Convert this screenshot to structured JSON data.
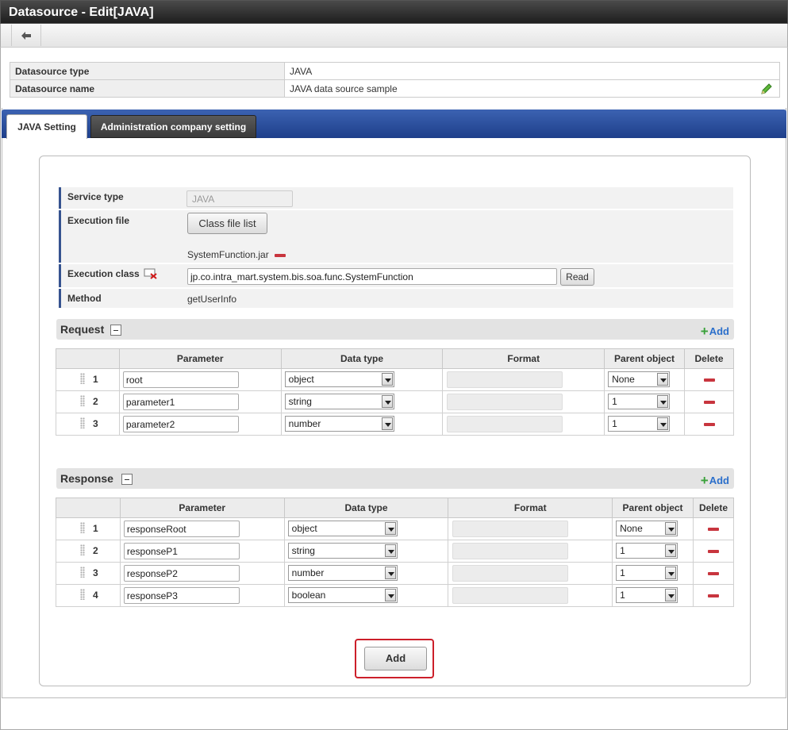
{
  "window": {
    "title": "Datasource - Edit[JAVA]"
  },
  "info": {
    "rows": [
      {
        "label": "Datasource type",
        "value": "JAVA"
      },
      {
        "label": "Datasource name",
        "value": "JAVA data source sample"
      }
    ]
  },
  "tabs": [
    {
      "label": "JAVA Setting",
      "active": true
    },
    {
      "label": "Administration company setting",
      "active": false
    }
  ],
  "settings": {
    "service_type_label": "Service type",
    "service_type_value": "JAVA",
    "execution_file_label": "Execution file",
    "class_file_list_button": "Class file list",
    "file_name": "SystemFunction.jar",
    "execution_class_label": "Execution class",
    "execution_class_value": "jp.co.intra_mart.system.bis.soa.func.SystemFunction",
    "read_button": "Read",
    "method_label": "Method",
    "method_value": "getUserInfo"
  },
  "request": {
    "title": "Request",
    "add_label": "Add",
    "columns": [
      "Parameter",
      "Data type",
      "Format",
      "Parent object",
      "Delete"
    ],
    "rows": [
      {
        "num": "1",
        "param": "root",
        "type": "object",
        "parent": "None"
      },
      {
        "num": "2",
        "param": "parameter1",
        "type": "string",
        "parent": "1"
      },
      {
        "num": "3",
        "param": "parameter2",
        "type": "number",
        "parent": "1"
      }
    ]
  },
  "response": {
    "title": "Response",
    "add_label": "Add",
    "columns": [
      "Parameter",
      "Data type",
      "Format",
      "Parent object",
      "Delete"
    ],
    "rows": [
      {
        "num": "1",
        "param": "responseRoot",
        "type": "object",
        "parent": "None"
      },
      {
        "num": "2",
        "param": "responseP1",
        "type": "string",
        "parent": "1"
      },
      {
        "num": "3",
        "param": "responseP2",
        "type": "number",
        "parent": "1"
      },
      {
        "num": "4",
        "param": "responseP3",
        "type": "boolean",
        "parent": "1"
      }
    ]
  },
  "footer": {
    "add_button": "Add"
  },
  "colors": {
    "accent_blue": "#2a4d9b",
    "danger_red": "#c8353e",
    "highlight_red": "#cc1f2a",
    "add_green": "#3aa13a",
    "link_blue": "#2b6fcb"
  }
}
